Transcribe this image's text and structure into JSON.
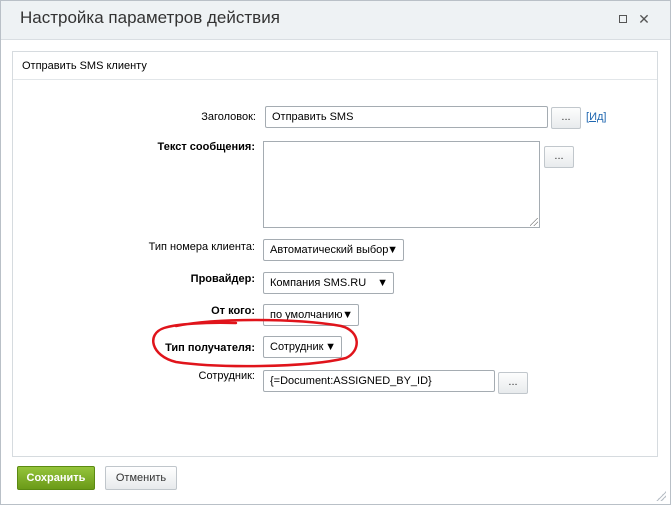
{
  "dialog": {
    "title": "Настройка параметров действия",
    "section_title": "Отправить SMS клиенту"
  },
  "fields": {
    "title_label": "Заголовок:",
    "title_value": "Отправить SMS",
    "id_link_prefix": "[",
    "id_link": "Ид",
    "id_link_suffix": "]",
    "message_label": "Текст сообщения:",
    "message_value": "",
    "number_type_label": "Тип номера клиента:",
    "number_type_value": "Автоматический выбор",
    "provider_label": "Провайдер:",
    "provider_value": "Компания SMS.RU",
    "from_label": "От кого:",
    "from_value": "по умолчанию",
    "recipient_type_label": "Тип получателя:",
    "recipient_type_value": "Сотрудник",
    "employee_label": "Сотрудник:",
    "employee_value": "{=Document:ASSIGNED_BY_ID}",
    "dots": "..."
  },
  "buttons": {
    "save": "Сохранить",
    "cancel": "Отменить"
  },
  "icons": {
    "maximize": "maximize-icon",
    "close": "close-icon",
    "dropdown": "dropdown-arrow-icon"
  },
  "colors": {
    "save_button": "#7cae23",
    "annotation": "#e0141b",
    "link": "#2067b0"
  }
}
